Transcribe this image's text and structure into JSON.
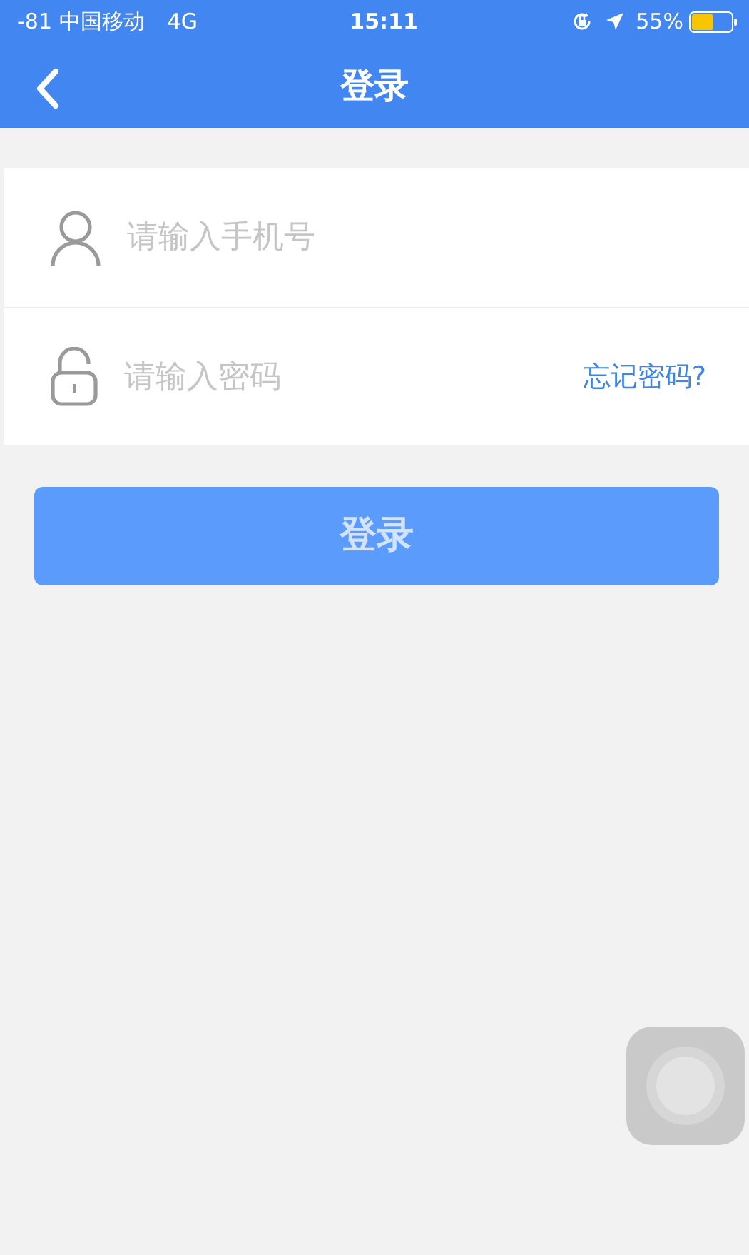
{
  "status_bar": {
    "carrier": "-81 中国移动",
    "network": "4G",
    "time": "15:11",
    "battery": "55%"
  },
  "nav": {
    "title": "登录"
  },
  "fields": [
    {
      "kind": "phone",
      "placeholder": "请输入手机号"
    },
    {
      "kind": "password",
      "placeholder": "请输入密码",
      "link": "忘记密码?"
    }
  ],
  "login_button": {
    "label": "登录",
    "disabled": true
  }
}
